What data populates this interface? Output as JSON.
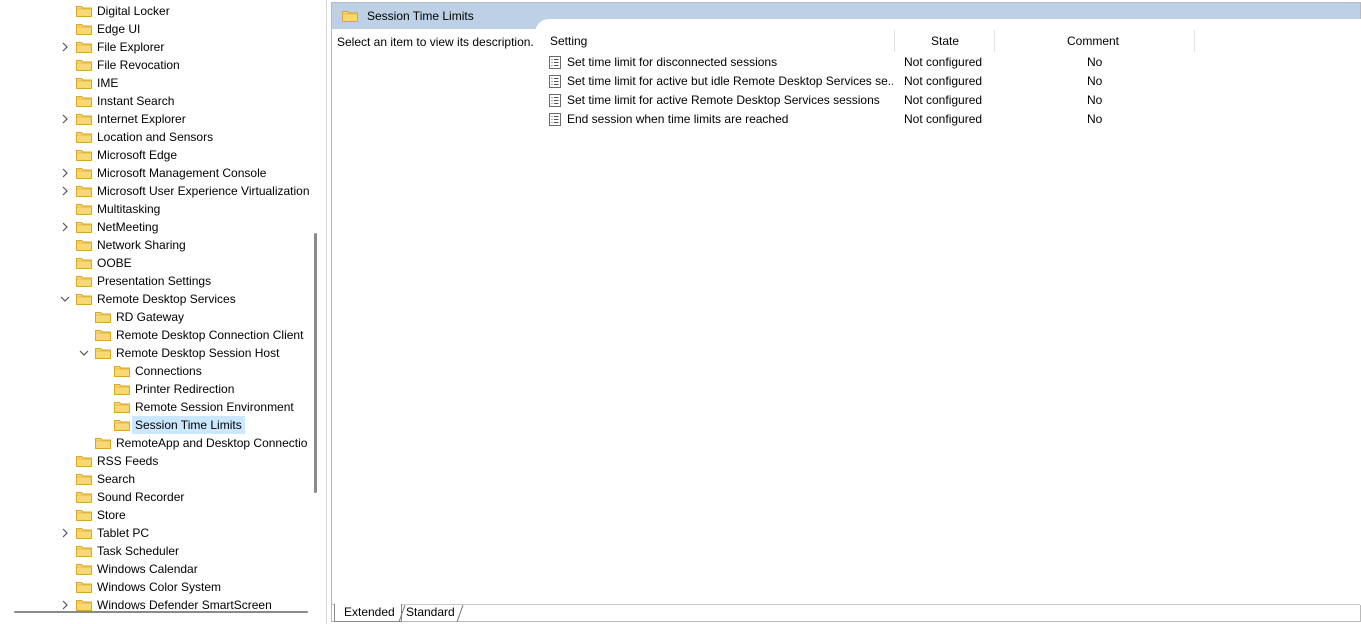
{
  "tree": {
    "items": [
      {
        "label": "Digital Locker",
        "expander": "none"
      },
      {
        "label": "Edge UI",
        "expander": "none"
      },
      {
        "label": "File Explorer",
        "expander": "collapsed"
      },
      {
        "label": "File Revocation",
        "expander": "none"
      },
      {
        "label": "IME",
        "expander": "none"
      },
      {
        "label": "Instant Search",
        "expander": "none"
      },
      {
        "label": "Internet Explorer",
        "expander": "collapsed"
      },
      {
        "label": "Location and Sensors",
        "expander": "none"
      },
      {
        "label": "Microsoft Edge",
        "expander": "none"
      },
      {
        "label": "Microsoft Management Console",
        "expander": "collapsed"
      },
      {
        "label": "Microsoft User Experience Virtualization",
        "expander": "collapsed"
      },
      {
        "label": "Multitasking",
        "expander": "none"
      },
      {
        "label": "NetMeeting",
        "expander": "collapsed"
      },
      {
        "label": "Network Sharing",
        "expander": "none"
      },
      {
        "label": "OOBE",
        "expander": "none"
      },
      {
        "label": "Presentation Settings",
        "expander": "none"
      },
      {
        "label": "Remote Desktop Services",
        "expander": "expanded"
      },
      {
        "label": "RD Gateway",
        "expander": "none"
      },
      {
        "label": "Remote Desktop Connection Client",
        "expander": "none"
      },
      {
        "label": "Remote Desktop Session Host",
        "expander": "expanded"
      },
      {
        "label": "Connections",
        "expander": "none"
      },
      {
        "label": "Printer Redirection",
        "expander": "none"
      },
      {
        "label": "Remote Session Environment",
        "expander": "none"
      },
      {
        "label": "Session Time Limits",
        "expander": "none",
        "selected": true
      },
      {
        "label": "RemoteApp and Desktop Connectio",
        "expander": "none"
      },
      {
        "label": "RSS Feeds",
        "expander": "none"
      },
      {
        "label": "Search",
        "expander": "none"
      },
      {
        "label": "Sound Recorder",
        "expander": "none"
      },
      {
        "label": "Store",
        "expander": "none"
      },
      {
        "label": "Tablet PC",
        "expander": "collapsed"
      },
      {
        "label": "Task Scheduler",
        "expander": "none"
      },
      {
        "label": "Windows Calendar",
        "expander": "none"
      },
      {
        "label": "Windows Color System",
        "expander": "none"
      },
      {
        "label": "Windows Defender SmartScreen",
        "expander": "collapsed"
      }
    ]
  },
  "header": {
    "title": "Session Time Limits",
    "icon": "folder-icon"
  },
  "description": {
    "text": "Select an item to view its description."
  },
  "table": {
    "columns": {
      "setting": "Setting",
      "state": "State",
      "comment": "Comment"
    },
    "rows": [
      {
        "setting": "Set time limit for disconnected sessions",
        "state": "Not configured",
        "comment": "No"
      },
      {
        "setting": "Set time limit for active but idle Remote Desktop Services se...",
        "state": "Not configured",
        "comment": "No"
      },
      {
        "setting": "Set time limit for active Remote Desktop Services sessions",
        "state": "Not configured",
        "comment": "No"
      },
      {
        "setting": "End session when time limits are reached",
        "state": "Not configured",
        "comment": "No"
      }
    ]
  },
  "tabs": {
    "extended": "Extended",
    "standard": "Standard"
  },
  "colors": {
    "header_band": "#bdd0e6",
    "selection": "#cce8ff",
    "folder_fill": "#f8d775",
    "folder_edge": "#d9a824"
  }
}
